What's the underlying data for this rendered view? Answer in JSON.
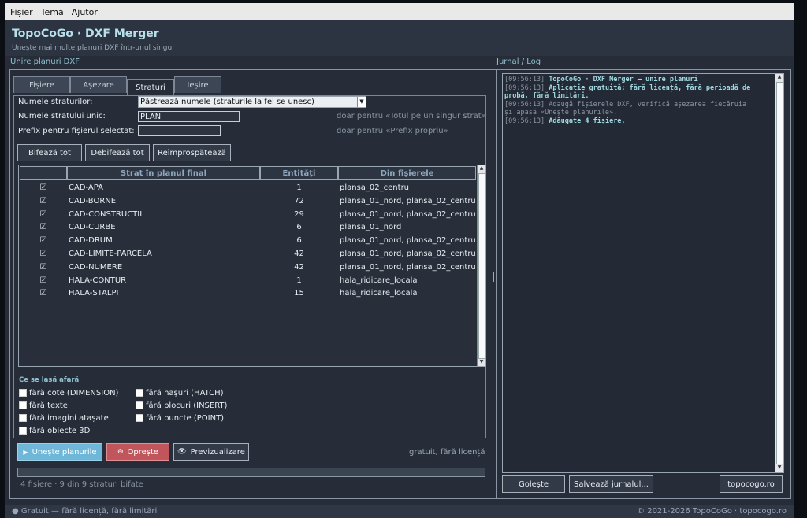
{
  "menu": {
    "file": "Fișier",
    "theme": "Temă",
    "help": "Ajutor"
  },
  "app": {
    "title": "TopoCoGo · DXF Merger",
    "subtitle": "Unește mai multe planuri DXF într-unul singur"
  },
  "left": {
    "section_label": "Unire planuri DXF",
    "tabs": [
      {
        "label": "Fișiere",
        "active": false
      },
      {
        "label": "Așezare",
        "active": false
      },
      {
        "label": "Straturi",
        "active": true
      },
      {
        "label": "Ieșire",
        "active": false
      }
    ],
    "form": {
      "layer_names_label": "Numele straturilor:",
      "layer_names_value": "Păstrează numele (straturile la fel se unesc)",
      "single_layer_label": "Numele stratului unic:",
      "single_layer_value": "PLAN",
      "single_layer_hint": "doar pentru «Totul pe un singur strat»",
      "prefix_label": "Prefix pentru fișierul selectat:",
      "prefix_value": "",
      "prefix_hint": "doar pentru «Prefix propriu»"
    },
    "buttons": {
      "check_all": "Bifează tot",
      "uncheck_all": "Debifează tot",
      "refresh": "Reîmprospătează"
    },
    "table": {
      "headers": [
        "",
        "Strat în planul final",
        "Entități",
        "Din fișierele"
      ],
      "rows": [
        {
          "check": "☑",
          "layer": "CAD-APA",
          "entities": "1",
          "files": "plansa_02_centru"
        },
        {
          "check": "☑",
          "layer": "CAD-BORNE",
          "entities": "72",
          "files": "plansa_01_nord, plansa_02_centru"
        },
        {
          "check": "☑",
          "layer": "CAD-CONSTRUCTII",
          "entities": "29",
          "files": "plansa_01_nord, plansa_02_centru"
        },
        {
          "check": "☑",
          "layer": "CAD-CURBE",
          "entities": "6",
          "files": "plansa_01_nord"
        },
        {
          "check": "☑",
          "layer": "CAD-DRUM",
          "entities": "6",
          "files": "plansa_01_nord, plansa_02_centru"
        },
        {
          "check": "☑",
          "layer": "CAD-LIMITE-PARCELA",
          "entities": "42",
          "files": "plansa_01_nord, plansa_02_centru"
        },
        {
          "check": "☑",
          "layer": "CAD-NUMERE",
          "entities": "42",
          "files": "plansa_01_nord, plansa_02_centru"
        },
        {
          "check": "☑",
          "layer": "HALA-CONTUR",
          "entities": "1",
          "files": "hala_ridicare_locala"
        },
        {
          "check": "☑",
          "layer": "HALA-STALPI",
          "entities": "15",
          "files": "hala_ridicare_locala"
        }
      ]
    },
    "exclude": {
      "title": "Ce se lasă afară",
      "options": [
        "fără cote (DIMENSION)",
        "fără hașuri (HATCH)",
        "fără texte",
        "fără blocuri (INSERT)",
        "fără imagini atașate",
        "fără puncte (POINT)",
        "fără obiecte 3D"
      ]
    },
    "actions": {
      "merge": "Unește planurile",
      "stop": "Oprește",
      "preview": "Previzualizare",
      "note": "gratuit, fără licență"
    },
    "status_text": "4 fișiere  ·  9 din 9 straturi bifate"
  },
  "right": {
    "section_label": "Jurnal / Log",
    "log": [
      {
        "time": "[09:56:13]",
        "text": "TopoCoGo · DXF Merger — unire planuri",
        "bold": true
      },
      {
        "time": "[09:56:13]",
        "text": "Aplicație gratuită: fără licență, fără perioadă de\nprobă, fără limitări.",
        "bold": true
      },
      {
        "time": "[09:56:13]",
        "text": "Adaugă fișierele DXF, verifică așezarea fiecăruia\nși apasă «Unește planurile».",
        "bold": false
      },
      {
        "time": "[09:56:13]",
        "text": "Adăugate 4 fișiere.",
        "bold": true
      }
    ],
    "buttons": {
      "clear": "Golește",
      "save": "Salvează jurnalul...",
      "site": "topocogo.ro"
    }
  },
  "statusbar": {
    "left": "● Gratuit — fără licență, fără limitări",
    "right": "© 2021-2026 TopoCoGo · topocogo.ro"
  }
}
